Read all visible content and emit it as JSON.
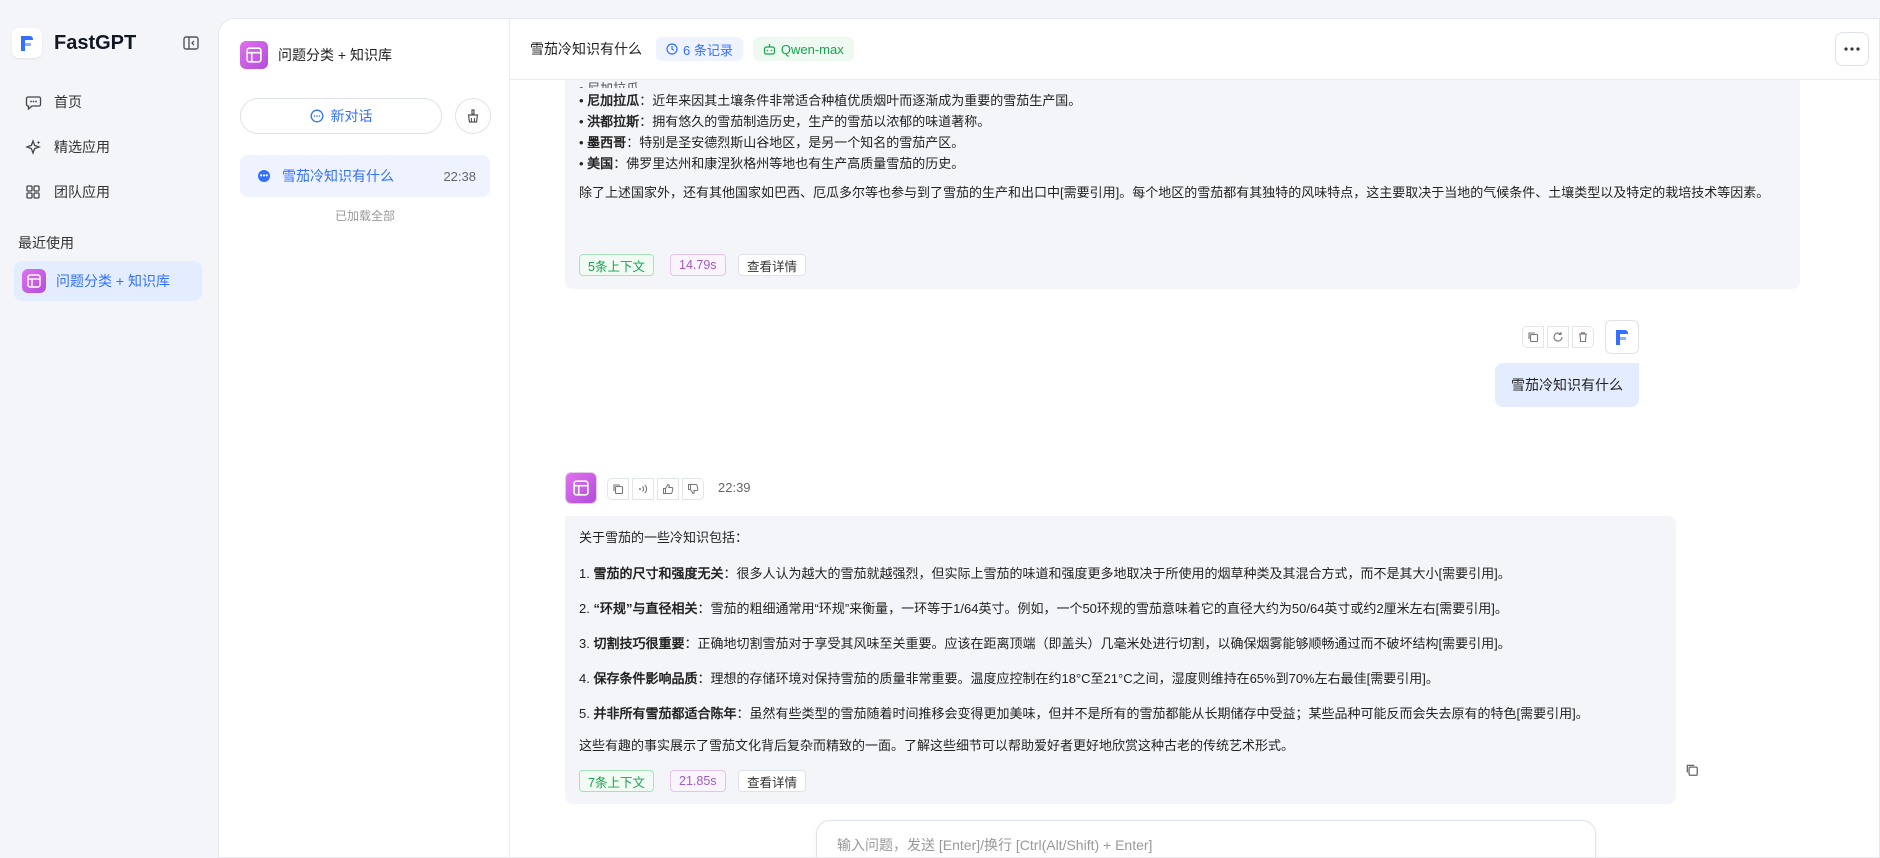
{
  "brand": {
    "name": "FastGPT"
  },
  "nav": [
    {
      "label": "首页",
      "icon": "chat-bubble-icon"
    },
    {
      "label": "精选应用",
      "icon": "sparkle-icon"
    },
    {
      "label": "团队应用",
      "icon": "grid-icon"
    }
  ],
  "recent": {
    "title": "最近使用",
    "items": [
      {
        "label": "问题分类 + 知识库"
      }
    ]
  },
  "history": {
    "app_name": "问题分类 + 知识库",
    "new_chat_label": "新对话",
    "items": [
      {
        "title": "雪茄冷知识有什么",
        "time": "22:38"
      }
    ],
    "loaded_all": "已加载全部"
  },
  "chat": {
    "title": "雪茄冷知识有什么",
    "records_tag": "6 条记录",
    "model_tag": "Qwen-max",
    "prev_answer": {
      "cut_line": "• 尼加拉瓜……",
      "list": [
        {
          "bold": "尼加拉瓜",
          "text": "：近年来因其土壤条件非常适合种植优质烟叶而逐渐成为重要的雪茄生产国。"
        },
        {
          "bold": "洪都拉斯",
          "text": "：拥有悠久的雪茄制造历史，生产的雪茄以浓郁的味道著称。"
        },
        {
          "bold": "墨西哥",
          "text": "：特别是圣安德烈斯山谷地区，是另一个知名的雪茄产区。"
        },
        {
          "bold": "美国",
          "text": "：佛罗里达州和康涅狄格州等地也有生产高质量雪茄的历史。"
        }
      ],
      "closing": "除了上述国家外，还有其他国家如巴西、厄瓜多尔等也参与到了雪茄的生产和出口中[需要引用]。每个地区的雪茄都有其独特的风味特点，这主要取决于当地的气候条件、土壤类型以及特定的栽培技术等因素。",
      "context_chip": "5条上下文",
      "time_chip": "14.79s",
      "detail_chip": "查看详情"
    },
    "user_message": "雪茄冷知识有什么",
    "answer": {
      "time": "22:39",
      "intro": "关于雪茄的一些冷知识包括：",
      "items": [
        {
          "num": "1.",
          "bold": "雪茄的尺寸和强度无关",
          "text": "：很多人认为越大的雪茄就越强烈，但实际上雪茄的味道和强度更多地取决于所使用的烟草种类及其混合方式，而不是其大小[需要引用]。"
        },
        {
          "num": "2.",
          "bold": "“环规”与直径相关",
          "text": "：雪茄的粗细通常用“环规”来衡量，一环等于1/64英寸。例如，一个50环规的雪茄意味着它的直径大约为50/64英寸或约2厘米左右[需要引用]。"
        },
        {
          "num": "3.",
          "bold": "切割技巧很重要",
          "text": "：正确地切割雪茄对于享受其风味至关重要。应该在距离顶端（即盖头）几毫米处进行切割，以确保烟雾能够顺畅通过而不破坏结构[需要引用]。"
        },
        {
          "num": "4.",
          "bold": "保存条件影响品质",
          "text": "：理想的存储环境对保持雪茄的质量非常重要。温度应控制在约18°C至21°C之间，湿度则维持在65%到70%左右最佳[需要引用]。"
        },
        {
          "num": "5.",
          "bold": "并非所有雪茄都适合陈年",
          "text": "：虽然有些类型的雪茄随着时间推移会变得更加美味，但并不是所有的雪茄都能从长期储存中受益；某些品种可能反而会失去原有的特色[需要引用]。"
        }
      ],
      "closing": "这些有趣的事实展示了雪茄文化背后复杂而精致的一面。了解这些细节可以帮助爱好者更好地欣赏这种古老的传统艺术形式。",
      "context_chip": "7条上下文",
      "time_chip": "21.85s",
      "detail_chip": "查看详情"
    },
    "input_placeholder": "输入问题，发送 [Enter]/换行 [Ctrl(Alt/Shift) + Enter]"
  },
  "colors": {
    "accent": "#3370ff",
    "app_gradient_start": "#e070f0",
    "app_gradient_end": "#b14ed8",
    "green": "#14a44d",
    "purple": "#a25bc4"
  }
}
